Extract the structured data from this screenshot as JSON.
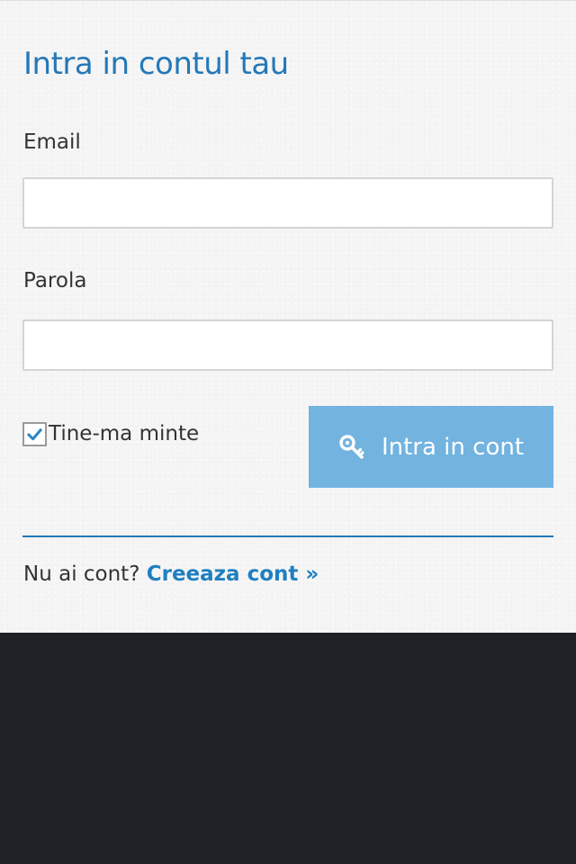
{
  "login": {
    "title": "Intra in contul tau",
    "email_label": "Email",
    "email_value": "",
    "password_label": "Parola",
    "password_value": "",
    "remember_label": "Tine-ma minte",
    "remember_checked": true,
    "submit_label": "Intra in cont",
    "submit_icon": "key-icon",
    "signup_prompt": "Nu ai cont?",
    "signup_link": "Creeaza cont »"
  },
  "colors": {
    "title": "#2478b8",
    "button": "#72b3e0",
    "link": "#1f7fc0",
    "divider": "#2478b8",
    "panel_background": "#f5f5f5",
    "page_background": "#1e2126"
  }
}
